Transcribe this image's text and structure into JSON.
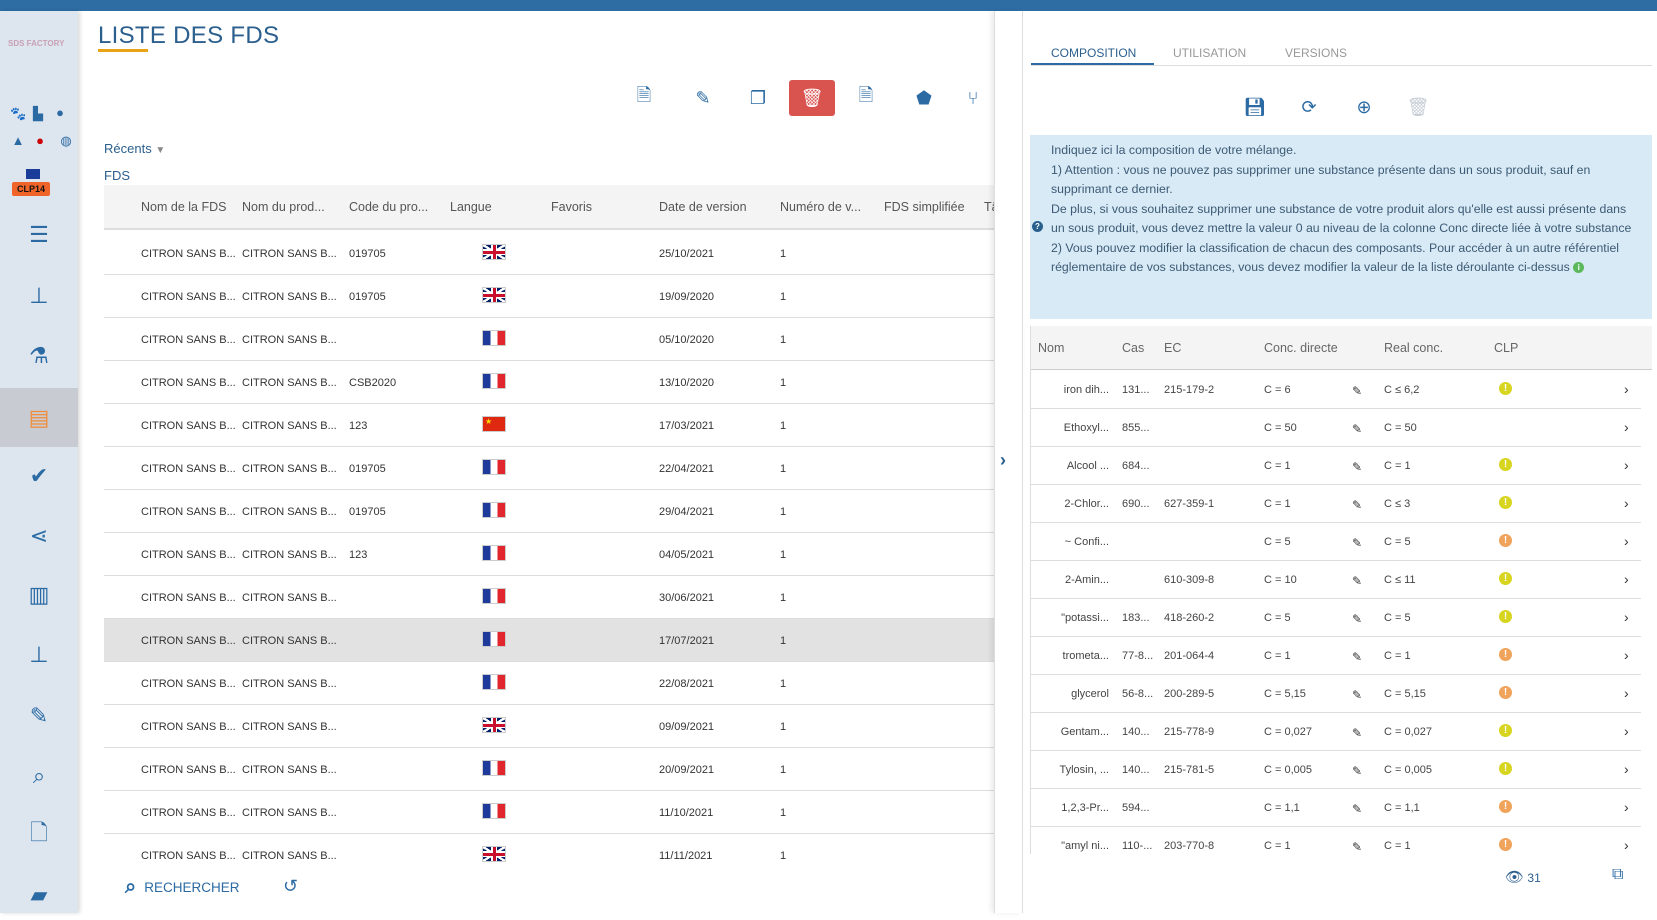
{
  "app": {
    "logo": "SDS FACTORY",
    "regulation_badge": "CLP14"
  },
  "colors": {
    "accent": "#2b6aa3",
    "danger": "#d9534f",
    "warn_yellow": "#d7d51f",
    "warn_orange": "#f0a35a",
    "active_nav": "#f08c3a"
  },
  "sidebar": {
    "top_icons": [
      "paw-icon",
      "factory-icon",
      "user-circle-icon",
      "bell-icon",
      "question-icon",
      "globe-icon"
    ],
    "nav": [
      "checklist-icon",
      "hierarchy-icon",
      "flask-icon",
      "document-icon",
      "check-icon",
      "share-icon",
      "book-icon",
      "sitemap-icon",
      "edit-icon",
      "search-icon",
      "file-info-icon",
      "folder-open-icon"
    ],
    "active_index": 3
  },
  "page": {
    "title": "LISTE DES FDS",
    "recents_label": "Récents",
    "fds_label": "FDS"
  },
  "toolbar": [
    "new-document-icon",
    "edit-icon",
    "duplicate-icon",
    "delete-icon",
    "export-document-icon",
    "tag-download-icon",
    "branch-icon"
  ],
  "list": {
    "columns": [
      "Nom de la FDS",
      "Nom du prod...",
      "Code du pro...",
      "Langue",
      "Favoris",
      "Date de version",
      "Numéro de v...",
      "FDS simplifiée",
      "Tâ"
    ],
    "rows": [
      {
        "name": "CITRON SANS B...",
        "product": "CITRON SANS B...",
        "code": "019705",
        "lang": "gb",
        "date": "25/10/2021",
        "num": "1"
      },
      {
        "name": "CITRON SANS B...",
        "product": "CITRON SANS B...",
        "code": "019705",
        "lang": "gb",
        "date": "19/09/2020",
        "num": "1"
      },
      {
        "name": "CITRON SANS B...",
        "product": "CITRON SANS B...",
        "code": "",
        "lang": "fr",
        "date": "05/10/2020",
        "num": "1"
      },
      {
        "name": "CITRON SANS B...",
        "product": "CITRON SANS B...",
        "code": "CSB2020",
        "lang": "fr",
        "date": "13/10/2020",
        "num": "1"
      },
      {
        "name": "CITRON SANS B...",
        "product": "CITRON SANS B...",
        "code": "123",
        "lang": "cn",
        "date": "17/03/2021",
        "num": "1"
      },
      {
        "name": "CITRON SANS B...",
        "product": "CITRON SANS B...",
        "code": "019705",
        "lang": "fr",
        "date": "22/04/2021",
        "num": "1"
      },
      {
        "name": "CITRON SANS B...",
        "product": "CITRON SANS B...",
        "code": "019705",
        "lang": "fr",
        "date": "29/04/2021",
        "num": "1"
      },
      {
        "name": "CITRON SANS B...",
        "product": "CITRON SANS B...",
        "code": "123",
        "lang": "fr",
        "date": "04/05/2021",
        "num": "1"
      },
      {
        "name": "CITRON SANS B...",
        "product": "CITRON SANS B...",
        "code": "",
        "lang": "fr",
        "date": "30/06/2021",
        "num": "1"
      },
      {
        "name": "CITRON SANS B...",
        "product": "CITRON SANS B...",
        "code": "",
        "lang": "fr",
        "date": "17/07/2021",
        "num": "1",
        "selected": true
      },
      {
        "name": "CITRON SANS B...",
        "product": "CITRON SANS B...",
        "code": "",
        "lang": "fr",
        "date": "22/08/2021",
        "num": "1"
      },
      {
        "name": "CITRON SANS B...",
        "product": "CITRON SANS B...",
        "code": "",
        "lang": "gb",
        "date": "09/09/2021",
        "num": "1"
      },
      {
        "name": "CITRON SANS B...",
        "product": "CITRON SANS B...",
        "code": "",
        "lang": "fr",
        "date": "20/09/2021",
        "num": "1"
      },
      {
        "name": "CITRON SANS B...",
        "product": "CITRON SANS B...",
        "code": "",
        "lang": "fr",
        "date": "11/10/2021",
        "num": "1"
      },
      {
        "name": "CITRON SANS B...",
        "product": "CITRON SANS B...",
        "code": "",
        "lang": "gb",
        "date": "11/11/2021",
        "num": "1"
      }
    ]
  },
  "footer": {
    "search_label": "RECHERCHER",
    "views": "31"
  },
  "panel": {
    "tabs": [
      "COMPOSITION",
      "UTILISATION",
      "VERSIONS"
    ],
    "active_tab": 0,
    "toolbar": [
      "save-icon",
      "refresh-icon",
      "add-circle-icon",
      "trash-icon"
    ],
    "info": [
      "Indiquez ici la composition de votre mélange.",
      "1) Attention : vous ne pouvez pas supprimer une substance présente dans un sous produit, sauf en supprimant ce dernier.",
      "De plus, si vous souhaitez supprimer une substance de votre produit alors qu'elle est aussi présente dans un sous produit, vous devez mettre la valeur 0 au niveau de la colonne Conc directe liée à votre substance",
      "2) Vous pouvez modifier la classification de chacun des composants. Pour accéder à un autre référentiel réglementaire de vos substances, vous devez modifier la valeur de la liste déroulante ci-dessus"
    ],
    "columns": [
      "Nom",
      "Cas",
      "EC",
      "Conc. directe",
      "Real conc.",
      "CLP"
    ],
    "rows": [
      {
        "nom": "iron dih...",
        "cas": "131...",
        "ec": "215-179-2",
        "conc": "C = 6",
        "real": "C ≤ 6,2",
        "clp": "yellow"
      },
      {
        "nom": "Ethoxyl...",
        "cas": "855...",
        "ec": "",
        "conc": "C = 50",
        "real": "C = 50",
        "clp": ""
      },
      {
        "nom": "Alcool ...",
        "cas": "684...",
        "ec": "",
        "conc": "C = 1",
        "real": "C = 1",
        "clp": "yellow"
      },
      {
        "nom": "2-Chlor...",
        "cas": "690...",
        "ec": "627-359-1",
        "conc": "C = 1",
        "real": "C ≤ 3",
        "clp": "yellow"
      },
      {
        "nom": "~ Confi...",
        "cas": "",
        "ec": "",
        "conc": "C = 5",
        "real": "C = 5",
        "clp": "orange"
      },
      {
        "nom": "2-Amin...",
        "cas": "",
        "ec": "610-309-8",
        "conc": "C = 10",
        "real": "C ≤ 11",
        "clp": "yellow"
      },
      {
        "nom": "\"potassi...",
        "cas": "183...",
        "ec": "418-260-2",
        "conc": "C = 5",
        "real": "C = 5",
        "clp": "yellow"
      },
      {
        "nom": "trometa...",
        "cas": "77-8...",
        "ec": "201-064-4",
        "conc": "C = 1",
        "real": "C = 1",
        "clp": "orange"
      },
      {
        "nom": "glycerol",
        "cas": "56-8...",
        "ec": "200-289-5",
        "conc": "C = 5,15",
        "real": "C = 5,15",
        "clp": "orange"
      },
      {
        "nom": "Gentam...",
        "cas": "140...",
        "ec": "215-778-9",
        "conc": "C = 0,027",
        "real": "C = 0,027",
        "clp": "yellow"
      },
      {
        "nom": "Tylosin, ...",
        "cas": "140...",
        "ec": "215-781-5",
        "conc": "C = 0,005",
        "real": "C = 0,005",
        "clp": "yellow"
      },
      {
        "nom": "1,2,3-Pr...",
        "cas": "594...",
        "ec": "",
        "conc": "C = 1,1",
        "real": "C = 1,1",
        "clp": "orange"
      },
      {
        "nom": "\"amyl ni...",
        "cas": "110-...",
        "ec": "203-770-8",
        "conc": "C = 1",
        "real": "C = 1",
        "clp": "orange"
      }
    ]
  }
}
